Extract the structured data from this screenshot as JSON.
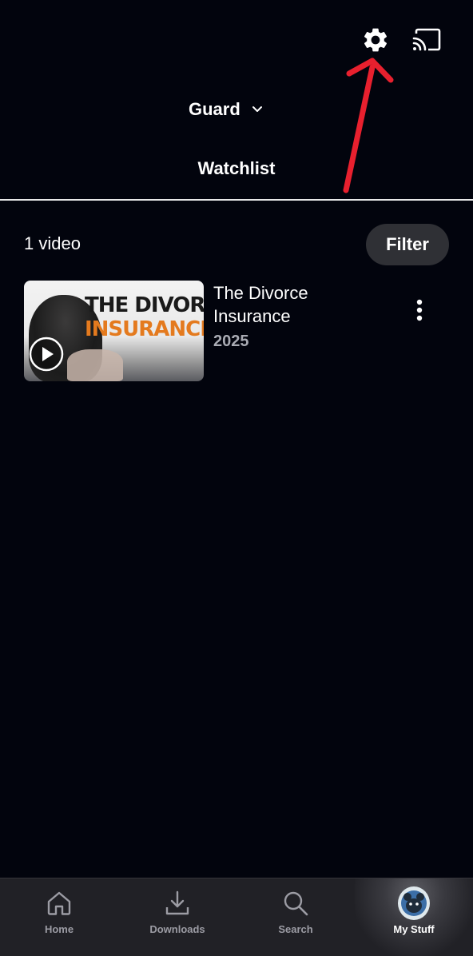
{
  "header": {
    "profile_name": "Guard",
    "page_title": "Watchlist",
    "icons": {
      "settings": "gear-icon",
      "cast": "cast-icon",
      "profile_menu": "chevron-down-icon"
    }
  },
  "list": {
    "count_label": "1 video",
    "filter_label": "Filter",
    "items": [
      {
        "title": "The Divorce Insurance",
        "year": "2025",
        "thumbnail_text_line1": "THE DIVORCE",
        "thumbnail_text_line2": "INSURANCE"
      }
    ]
  },
  "bottom_nav": {
    "items": [
      {
        "label": "Home",
        "icon": "home-icon"
      },
      {
        "label": "Downloads",
        "icon": "download-icon"
      },
      {
        "label": "Search",
        "icon": "search-icon"
      },
      {
        "label": "My Stuff",
        "icon": "avatar"
      }
    ],
    "active": "My Stuff"
  },
  "colors": {
    "background": "#02040d",
    "nav_background": "#212126",
    "filter_button": "#2f3035",
    "annotation_arrow": "#e8202e",
    "thumbnail_accent": "#e47a1e"
  }
}
